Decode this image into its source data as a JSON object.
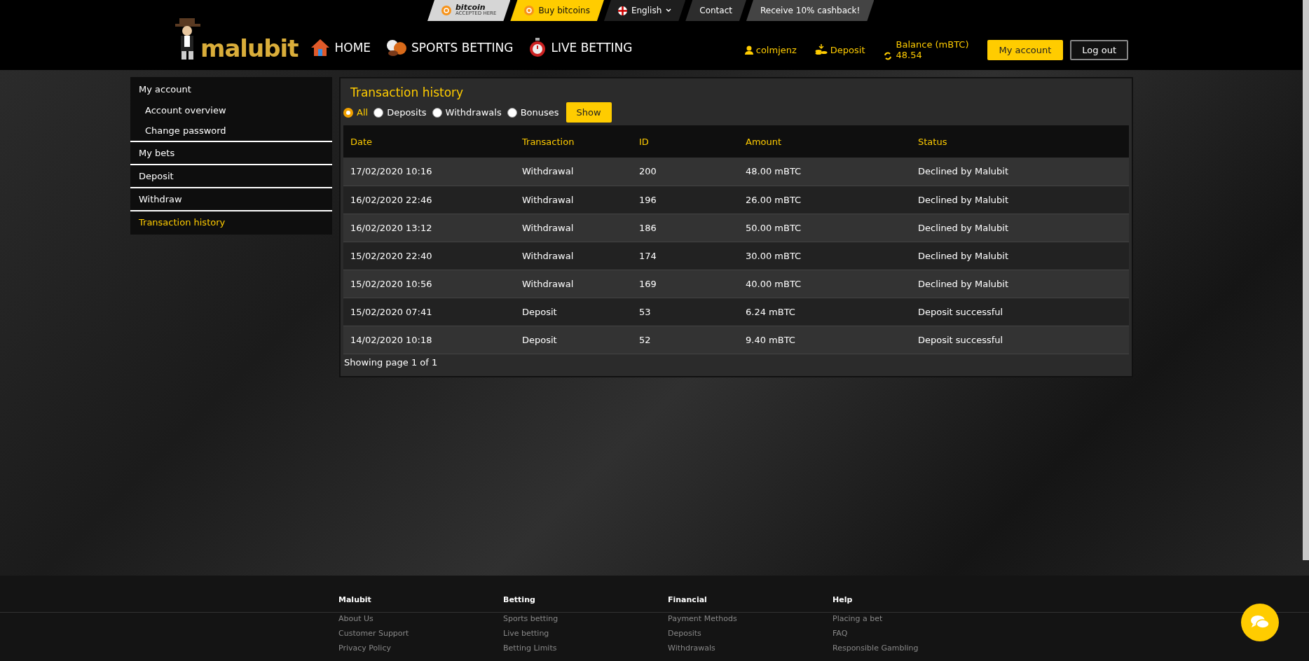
{
  "top_strip": {
    "bitcoin_badge": {
      "title": "bitcoin",
      "subtitle": "ACCEPTED HERE"
    },
    "links": [
      {
        "label": "Buy bitcoins",
        "kind": "buy"
      },
      {
        "label": "English",
        "kind": "language"
      },
      {
        "label": "Contact",
        "kind": "plain"
      },
      {
        "label": "Receive 10% cashback!",
        "kind": "promo"
      }
    ]
  },
  "header": {
    "logo": "malubit",
    "nav": [
      {
        "label": "HOME",
        "kind": "home"
      },
      {
        "label": "SPORTS BETTING",
        "kind": "sports"
      },
      {
        "label": "LIVE BETTING",
        "kind": "live"
      }
    ],
    "user": "colmjenz",
    "deposit": "Deposit",
    "balance_label": "Balance (mBTC)",
    "balance": "48.54",
    "buttons": [
      {
        "label": "My account",
        "kind": "primary"
      },
      {
        "label": "Log out",
        "kind": "outline"
      }
    ]
  },
  "sidebar": {
    "items": [
      {
        "label": "My account",
        "kind": "section",
        "selected": false
      },
      {
        "label": "Account overview",
        "kind": "sub",
        "selected": false
      },
      {
        "label": "Change password",
        "kind": "sub",
        "selected": false
      },
      {
        "label": "My bets",
        "kind": "section",
        "selected": false
      },
      {
        "label": "Deposit",
        "kind": "section",
        "selected": false
      },
      {
        "label": "Withdraw",
        "kind": "section",
        "selected": false
      },
      {
        "label": "Transaction history",
        "kind": "section",
        "selected": true
      }
    ]
  },
  "panel": {
    "title": "Transaction history",
    "filters": [
      {
        "label": "All",
        "selected": true
      },
      {
        "label": "Deposits",
        "selected": false
      },
      {
        "label": "Withdrawals",
        "selected": false
      },
      {
        "label": "Bonuses",
        "selected": false
      }
    ],
    "show_button": "Show",
    "table": {
      "columns": [
        "Date",
        "Transaction",
        "ID",
        "Amount",
        "Status"
      ],
      "rows": [
        [
          "17/02/2020 10:16",
          "Withdrawal",
          "200",
          "48.00 mBTC",
          "Declined by Malubit"
        ],
        [
          "16/02/2020 22:46",
          "Withdrawal",
          "196",
          "26.00 mBTC",
          "Declined by Malubit"
        ],
        [
          "16/02/2020 13:12",
          "Withdrawal",
          "186",
          "50.00 mBTC",
          "Declined by Malubit"
        ],
        [
          "15/02/2020 22:40",
          "Withdrawal",
          "174",
          "30.00 mBTC",
          "Declined by Malubit"
        ],
        [
          "15/02/2020 10:56",
          "Withdrawal",
          "169",
          "40.00 mBTC",
          "Declined by Malubit"
        ],
        [
          "15/02/2020 07:41",
          "Deposit",
          "53",
          "6.24 mBTC",
          "Deposit successful"
        ],
        [
          "14/02/2020 10:18",
          "Deposit",
          "52",
          "9.40 mBTC",
          "Deposit successful"
        ]
      ]
    },
    "pagination": "Showing page 1 of 1"
  },
  "footer": {
    "columns": [
      {
        "heading": "Malubit",
        "links": [
          "About Us",
          "Customer Support",
          "Privacy Policy"
        ]
      },
      {
        "heading": "Betting",
        "links": [
          "Sports betting",
          "Live betting",
          "Betting Limits"
        ]
      },
      {
        "heading": "Financial",
        "links": [
          "Payment Methods",
          "Deposits",
          "Withdrawals"
        ]
      },
      {
        "heading": "Help",
        "links": [
          "Placing a bet",
          "FAQ",
          "Responsible Gambling"
        ]
      }
    ]
  }
}
